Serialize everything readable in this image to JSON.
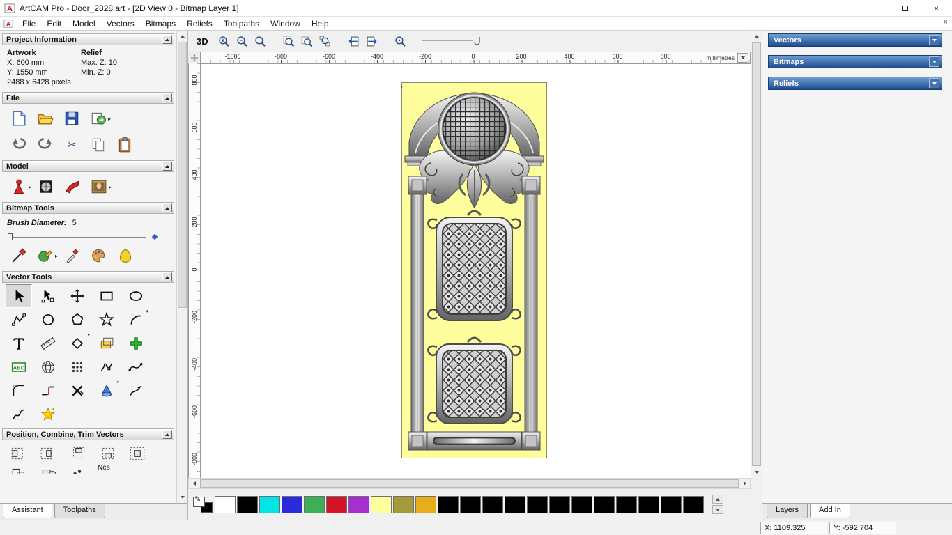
{
  "window": {
    "logo_letter": "A",
    "title": "ArtCAM Pro - Door_2828.art - [2D View:0 - Bitmap Layer 1]",
    "close_glyph": "×"
  },
  "menubar": {
    "items": [
      "File",
      "Edit",
      "Model",
      "Vectors",
      "Bitmaps",
      "Reliefs",
      "Toolpaths",
      "Window",
      "Help"
    ],
    "close_glyph": "×"
  },
  "assistant": {
    "tabs": [
      "Assistant",
      "Toolpaths"
    ],
    "project": {
      "title": "Project Information",
      "artwork_label": "Artwork",
      "relief_label": "Relief",
      "x": "X: 600 mm",
      "y": "Y: 1550 mm",
      "pixels": "2488 x 6428 pixels",
      "max_z": "Max. Z: 10",
      "min_z": "Min. Z: 0"
    },
    "file": {
      "title": "File",
      "icons": [
        "new-model",
        "open-model",
        "save-model",
        "import-model",
        "undo",
        "redo",
        "cut",
        "copy",
        "paste"
      ]
    },
    "model": {
      "title": "Model",
      "icons": [
        "set-model-size",
        "greyscale-view",
        "shading-setup",
        "load-picture"
      ]
    },
    "bitmap_tools": {
      "title": "Bitmap Tools",
      "brush_label": "Brush Diameter:",
      "brush_value": "5",
      "icons": [
        "paint",
        "draw",
        "pick-colour",
        "colour-palette",
        "flood-fill"
      ]
    },
    "vector_tools": {
      "title": "Vector Tools",
      "abc_label": "ABC",
      "icons": [
        "select-vectors",
        "transform-vectors",
        "pan-view",
        "create-rectangle",
        "create-ellipse",
        "create-polyline",
        "create-circle",
        "create-polygon",
        "create-star",
        "create-arc",
        "create-text",
        "measure",
        "create-door-shape",
        "offset-vectors",
        "block-paste",
        "text-on-curve",
        "wrap-vectors",
        "block-copy",
        "node-editing",
        "fit-curve",
        "fillet-vectors",
        "join-vectors",
        "trim-vectors",
        "spin-relief",
        "free-fillet",
        "cross-section",
        "magic-wand"
      ]
    },
    "position": {
      "title": "Position, Combine, Trim Vectors",
      "nesting_label": "Nes",
      "icons": [
        "align-left",
        "align-right",
        "align-top",
        "align-bottom",
        "centre-in-page",
        "group-vectors",
        "weld-vectors",
        "subtract-vectors",
        "nesting"
      ]
    }
  },
  "view2d": {
    "toolbar": {
      "view_3d": "3D",
      "icons": [
        "zoom-in",
        "zoom-out",
        "zoom-scale",
        "zoom-fit-page",
        "zoom-fit-drawing",
        "zoom-objects",
        "previous-bitmap-layer",
        "next-bitmap-layer",
        "zoom-previous",
        "toolbar-grip"
      ]
    },
    "ruler": {
      "unit": "millimetres",
      "h_ticks": [
        "-1000",
        "-800",
        "-600",
        "-400",
        "-200",
        "0",
        "200",
        "400",
        "600",
        "800"
      ],
      "v_ticks": [
        "800",
        "600",
        "400",
        "200",
        "0",
        "-200",
        "-400",
        "-600",
        "-800"
      ]
    },
    "artwork": "ornate-door-bitmap",
    "door_color": "#feff9c"
  },
  "right_panel": {
    "sections": [
      "Vectors",
      "Bitmaps",
      "Reliefs"
    ],
    "tabs": [
      "Layers",
      "Add In"
    ]
  },
  "palette": {
    "colors": [
      "#ffffff",
      "#000000",
      "#00e6e6",
      "#2b2bd9",
      "#3fae58",
      "#d41528",
      "#a62fd0",
      "#feff9c",
      "#a39b3a",
      "#e7ae1c",
      "#000000",
      "#000000",
      "#000000",
      "#000000",
      "#000000",
      "#000000",
      "#000000",
      "#000000",
      "#000000",
      "#000000",
      "#000000",
      "#000000"
    ]
  },
  "statusbar": {
    "x": "X: 1109.325",
    "y": "Y: -592.704"
  }
}
